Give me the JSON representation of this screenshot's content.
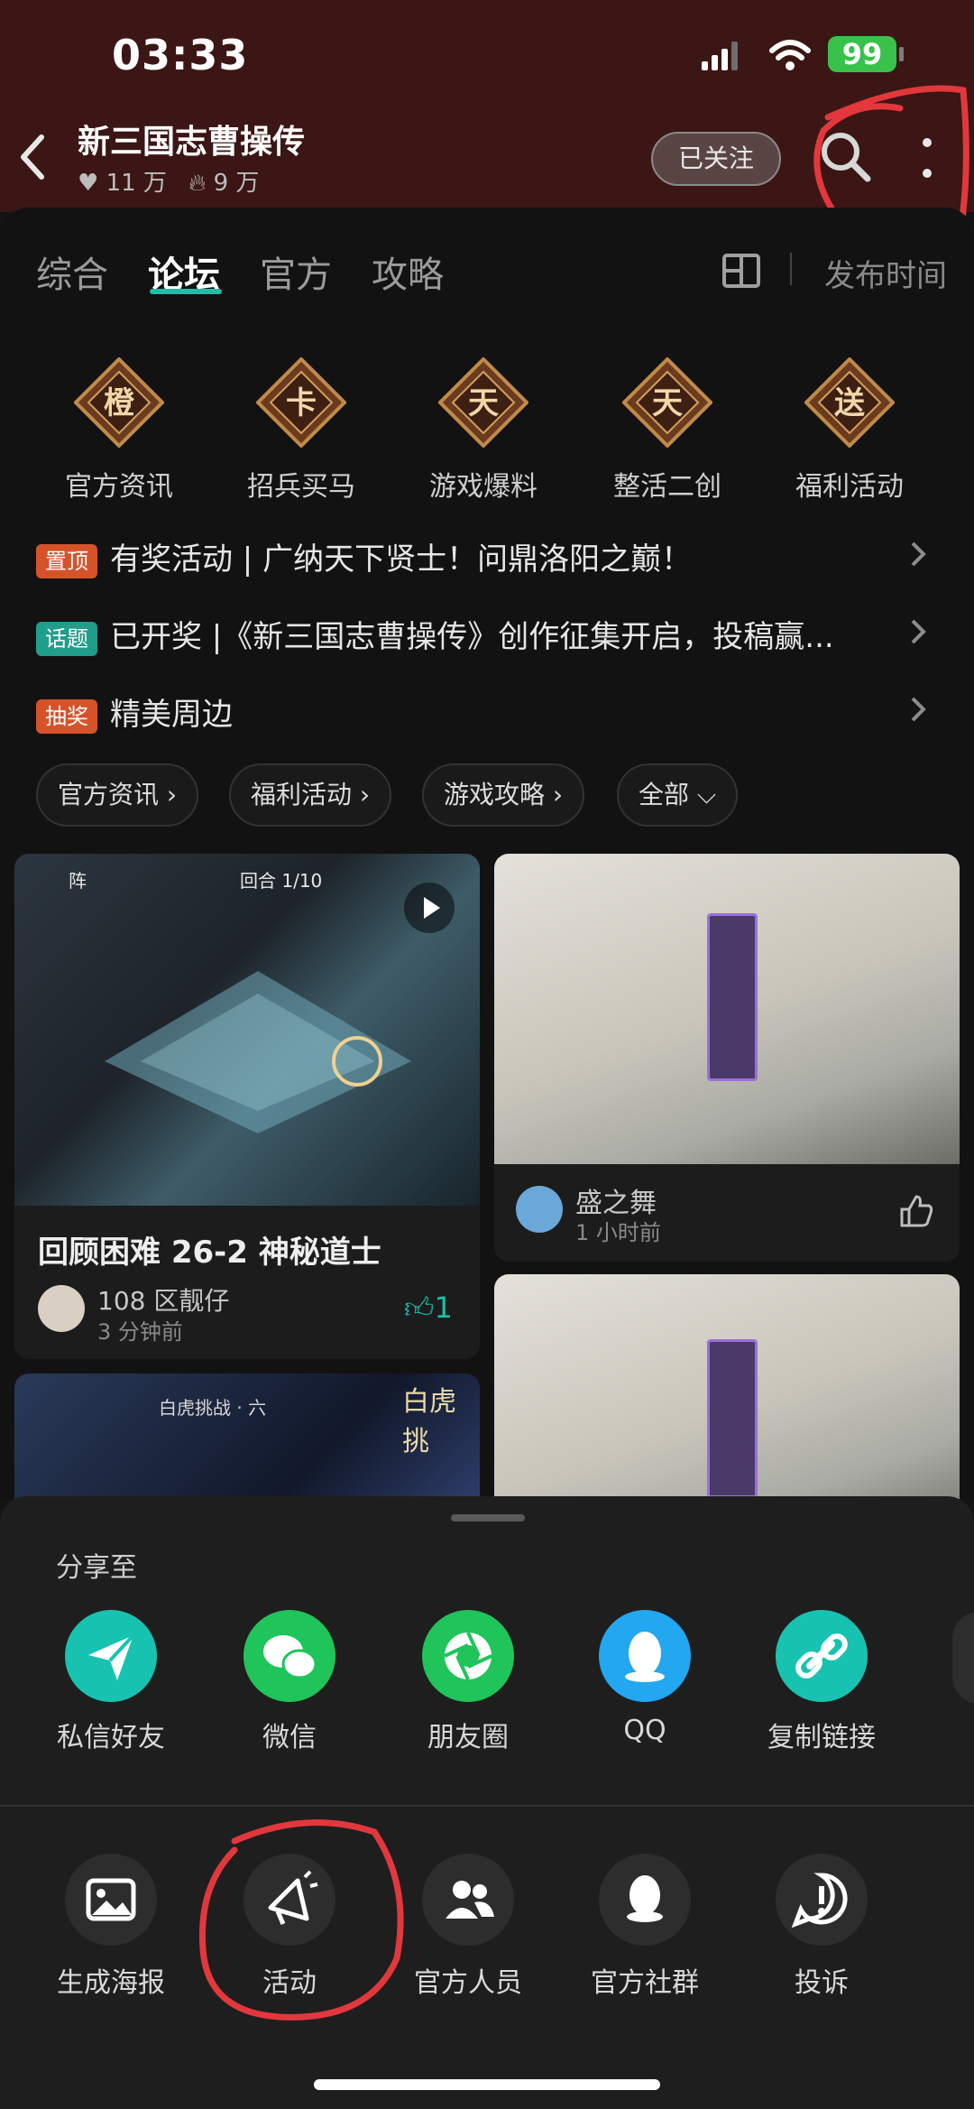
{
  "status_bar": {
    "time": "03:33",
    "battery": "99"
  },
  "header": {
    "title": "新三国志曹操传",
    "likes": "11 万",
    "heat": "9 万",
    "follow_label": "已关注"
  },
  "tabs": [
    {
      "label": "综合"
    },
    {
      "label": "论坛"
    },
    {
      "label": "官方"
    },
    {
      "label": "攻略"
    }
  ],
  "sort_label": "发布时间",
  "categories": [
    {
      "icon_char": "橙",
      "label": "官方资讯"
    },
    {
      "icon_char": "卡",
      "label": "招兵买马"
    },
    {
      "icon_char": "天",
      "label": "游戏爆料"
    },
    {
      "icon_char": "天",
      "label": "整活二创"
    },
    {
      "icon_char": "送",
      "label": "福利活动"
    }
  ],
  "notices": [
    {
      "badge": "置顶",
      "badge_color": "#d6532a",
      "text": "有奖活动 | 广纳天下贤士！问鼎洛阳之巅！"
    },
    {
      "badge": "话题",
      "badge_color": "#1f9e8b",
      "text": "已开奖 |《新三国志曹操传》创作征集开启，投稿赢..."
    },
    {
      "badge": "抽奖",
      "badge_color": "#d6532a",
      "text": "精美周边"
    }
  ],
  "filter_chips": [
    {
      "label": "官方资讯"
    },
    {
      "label": "福利活动"
    },
    {
      "label": "游戏攻略"
    },
    {
      "label": "全部"
    }
  ],
  "posts": [
    {
      "title": "回顾困难 26-2 神秘道士",
      "author": "108 区靓仔",
      "time": "3 分钟前",
      "likes": "1",
      "overlay_text": "回合 1/10",
      "overlay_text2": "阵"
    },
    {
      "author": "盛之舞",
      "time": "1 小时前"
    }
  ],
  "bottom_card_texts": {
    "left_title": "白虎挑战 · 六",
    "left_banner": "白虎挑"
  },
  "share_sheet": {
    "title": "分享至",
    "targets": [
      {
        "label": "私信好友",
        "icon": "paper-plane-icon",
        "color": "#17c3b0"
      },
      {
        "label": "微信",
        "icon": "wechat-icon",
        "color": "#1fc45a"
      },
      {
        "label": "朋友圈",
        "icon": "moments-shutter-icon",
        "color": "#1fc45a"
      },
      {
        "label": "QQ",
        "icon": "qq-penguin-icon",
        "color": "#22a7f0"
      },
      {
        "label": "复制链接",
        "icon": "link-icon",
        "color": "#17c3b0"
      }
    ],
    "actions": [
      {
        "label": "生成海报",
        "icon": "image-icon"
      },
      {
        "label": "活动",
        "icon": "megaphone-icon"
      },
      {
        "label": "官方人员",
        "icon": "people-icon"
      },
      {
        "label": "官方社群",
        "icon": "qq-penguin-icon"
      },
      {
        "label": "投诉",
        "icon": "alert-icon"
      }
    ]
  },
  "colors": {
    "header_bg": "#3b1614",
    "accent": "#19c0a6",
    "annotation": "#e2383d"
  }
}
